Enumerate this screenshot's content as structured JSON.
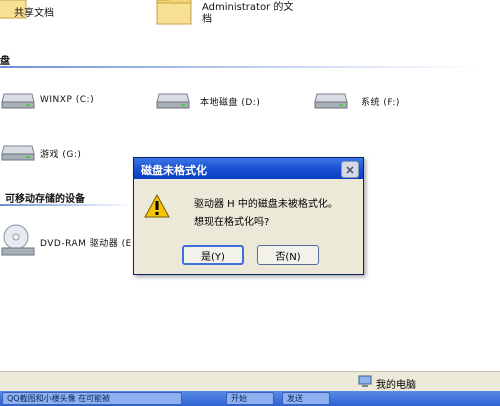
{
  "folders": [
    {
      "label": "共享文档",
      "icon": "folder-icon"
    },
    {
      "label_line1": "Administrator 的文",
      "label_line2": "档",
      "icon": "folder-icon"
    }
  ],
  "sections": {
    "hard_drives_header": "盘",
    "removable_header": "可移动存储的设备"
  },
  "drives": [
    {
      "label": "WINXP (C:)",
      "icon": "hard-drive-icon"
    },
    {
      "label": "本地磁盘 (D:)",
      "icon": "hard-drive-icon"
    },
    {
      "label": "系统 (F:)",
      "icon": "hard-drive-icon"
    },
    {
      "label": "游戏 (G:)",
      "icon": "hard-drive-icon"
    }
  ],
  "removable": [
    {
      "label": "DVD-RAM 驱动器 (E",
      "icon": "dvd-drive-icon"
    }
  ],
  "dialog": {
    "title": "磁盘未格式化",
    "message_line1": "驱动器 H 中的磁盘未被格式化。",
    "message_line2": "想现在格式化吗?",
    "yes_label": "是(Y)",
    "no_label": "否(N)"
  },
  "statusbar": {
    "location": "我的电脑"
  },
  "taskbar": {
    "item1": "QQ截图和小楼头像  在可能被",
    "item2": "开始",
    "item3": "发送"
  },
  "colors": {
    "title_bar": "#1d54d4",
    "dialog_face": "#ece9d8",
    "warning": "#f5c400"
  }
}
